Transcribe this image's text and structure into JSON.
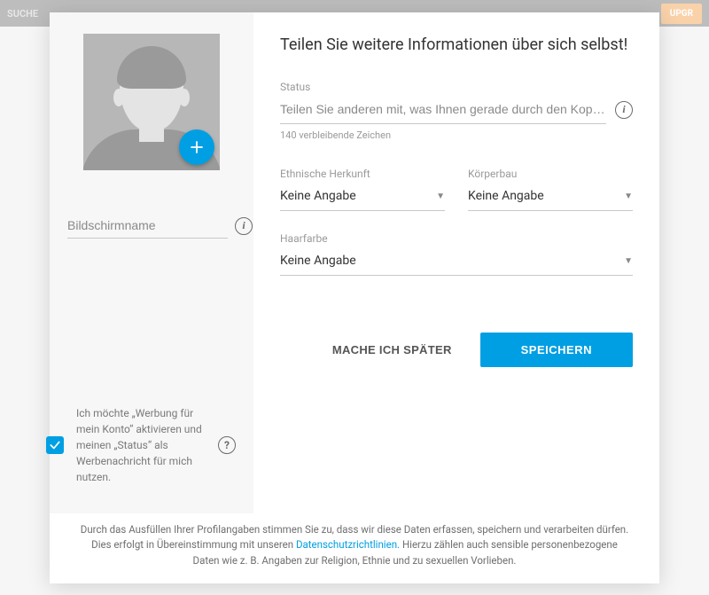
{
  "bg": {
    "left": "SUCHE",
    "right": "UPGR"
  },
  "title": "Teilen Sie weitere Informationen über sich selbst!",
  "avatar": {
    "add_icon": "plus-icon"
  },
  "screenname": {
    "placeholder": "Bildschirmname",
    "value": ""
  },
  "status": {
    "label": "Status",
    "placeholder": "Teilen Sie anderen mit, was Ihnen gerade durch den Kopf geh…",
    "value": "",
    "counter": "140 verbleibende Zeichen"
  },
  "selects": {
    "ethnicity": {
      "label": "Ethnische Herkunft",
      "value": "Keine Angabe"
    },
    "body": {
      "label": "Körperbau",
      "value": "Keine Angabe"
    },
    "hair": {
      "label": "Haarfarbe",
      "value": "Keine Angabe"
    }
  },
  "consent": {
    "checked": true,
    "text": "Ich möchte „Werbung für mein Konto“ aktivieren und meinen „Status“ als Werbenachricht für mich nutzen."
  },
  "actions": {
    "later": "MACHE ICH SPÄTER",
    "save": "SPEICHERN"
  },
  "footer": {
    "line1": "Durch das Ausfüllen Ihrer Profilangaben stimmen Sie zu, dass wir diese Daten erfassen, speichern und verarbeiten dürfen.",
    "line2a": "Dies erfolgt in Übereinstimmung mit unseren ",
    "link": "Datenschutzrichtlinien.",
    "line2b": " Hierzu zählen auch sensible personenbezogene Daten wie z. B. Angaben zur Religion, Ethnie und zu sexuellen Vorlieben."
  }
}
